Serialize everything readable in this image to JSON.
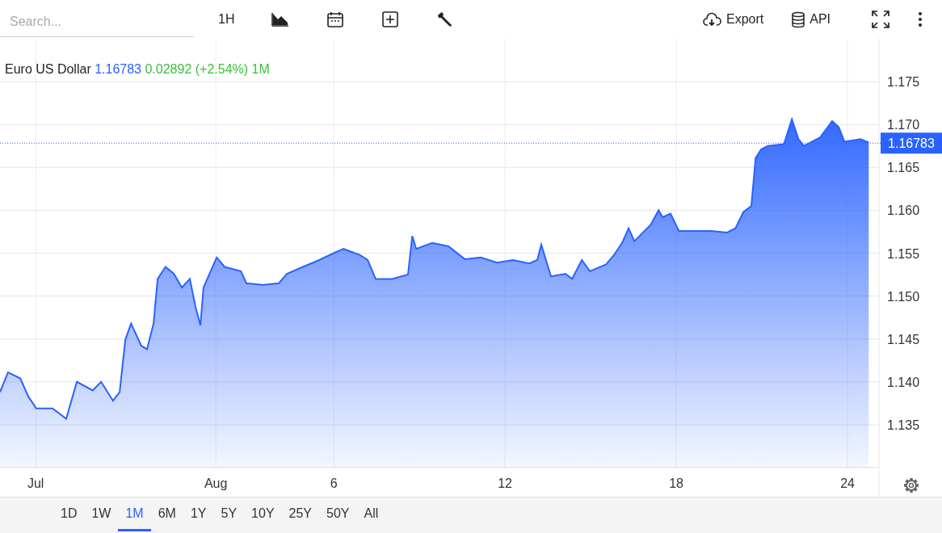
{
  "toolbar": {
    "search": {
      "placeholder": "Search..."
    },
    "interval": "1H",
    "actions": [
      {
        "kind": "export",
        "label": "Export"
      },
      {
        "kind": "api",
        "label": "API"
      }
    ]
  },
  "legend": {
    "price": "1.16783",
    "change": "0.02892 (+2.54%)",
    "period": "1M"
  },
  "chart": {
    "chart_data": {
      "type": "area",
      "grid": true,
      "ref_lines": [
        {
          "axis": "y",
          "value": 1.16783,
          "label": "1.16783"
        }
      ],
      "x": [
        -5.69,
        -5.41,
        -4.98,
        -4.7,
        -4.42,
        -3.85,
        -3.37,
        -3.0,
        -2.44,
        -2.15,
        -1.73,
        -1.5,
        -1.3,
        -1.1,
        -0.74,
        -0.54,
        -0.31,
        -0.17,
        0.11,
        0.4,
        0.68,
        0.96,
        1.16,
        1.33,
        1.44,
        1.9,
        2.18,
        2.75,
        2.94,
        3.51,
        4.08,
        4.36,
        4.92,
        5.49,
        6.06,
        6.34,
        6.91,
        7.19,
        7.47,
        8.04,
        8.6,
        8.75,
        8.89,
        9.45,
        10.02,
        10.59,
        11.15,
        11.72,
        12.28,
        12.85,
        13.13,
        13.27,
        13.61,
        14.12,
        14.35,
        14.69,
        14.97,
        15.54,
        15.82,
        16.1,
        16.33,
        16.53,
        17.1,
        17.38,
        17.52,
        17.8,
        18.09,
        18.65,
        19.22,
        19.78,
        20.07,
        20.35,
        20.63,
        20.78,
        20.97,
        21.2,
        21.77,
        22.05,
        22.28,
        22.47,
        23.04,
        23.46,
        23.69,
        23.89,
        24.45,
        24.74
      ],
      "series": [
        {
          "name": "Euro US Dollar",
          "color": "#2962ff",
          "values": [
            1.1388,
            1.1411,
            1.1404,
            1.1383,
            1.1369,
            1.1369,
            1.1357,
            1.14,
            1.139,
            1.14,
            1.1378,
            1.1388,
            1.1449,
            1.1468,
            1.1442,
            1.1438,
            1.1468,
            1.152,
            1.1534,
            1.1526,
            1.151,
            1.152,
            1.1487,
            1.1466,
            1.151,
            1.1545,
            1.1534,
            1.1529,
            1.1515,
            1.1513,
            1.1515,
            1.1526,
            1.1534,
            1.1542,
            1.1551,
            1.1555,
            1.1548,
            1.1542,
            1.152,
            1.152,
            1.1525,
            1.157,
            1.1555,
            1.1562,
            1.1558,
            1.1543,
            1.1545,
            1.1539,
            1.1542,
            1.1538,
            1.1542,
            1.156,
            1.1523,
            1.1526,
            1.152,
            1.1542,
            1.1529,
            1.1537,
            1.1548,
            1.1562,
            1.1579,
            1.1564,
            1.1583,
            1.16,
            1.1592,
            1.1596,
            1.1576,
            1.1576,
            1.1576,
            1.1574,
            1.1579,
            1.1598,
            1.1605,
            1.1661,
            1.1671,
            1.1675,
            1.1677,
            1.1706,
            1.1683,
            1.1675,
            1.1685,
            1.1704,
            1.1697,
            1.168,
            1.1683,
            1.1679
          ]
        }
      ],
      "xlim": [
        -5.69,
        25.1
      ],
      "ylim": [
        1.13,
        1.18
      ],
      "xticks": [
        {
          "value": -4.44,
          "label": "Jul"
        },
        {
          "value": 1.87,
          "label": "Aug"
        },
        6,
        12,
        18,
        24
      ],
      "yticks": [
        {
          "value": 1.135,
          "label": "1.135"
        },
        {
          "value": 1.14,
          "label": "1.140"
        },
        {
          "value": 1.145,
          "label": "1.145"
        },
        {
          "value": 1.15,
          "label": "1.150"
        },
        {
          "value": 1.155,
          "label": "1.155"
        },
        {
          "value": 1.16,
          "label": "1.160"
        },
        {
          "value": 1.165,
          "label": "1.165"
        },
        {
          "value": 1.17,
          "label": "1.170"
        },
        {
          "value": 1.175,
          "label": "1.175"
        }
      ]
    }
  },
  "ranges": [
    {
      "label": "1D",
      "selected": false
    },
    {
      "label": "1W",
      "selected": false
    },
    {
      "label": "1M",
      "selected": true
    },
    {
      "label": "6M",
      "selected": false
    },
    {
      "label": "1Y",
      "selected": false
    },
    {
      "label": "5Y",
      "selected": false
    },
    {
      "label": "10Y",
      "selected": false
    },
    {
      "label": "25Y",
      "selected": false
    },
    {
      "label": "50Y",
      "selected": false
    },
    {
      "label": "All",
      "selected": false
    }
  ]
}
